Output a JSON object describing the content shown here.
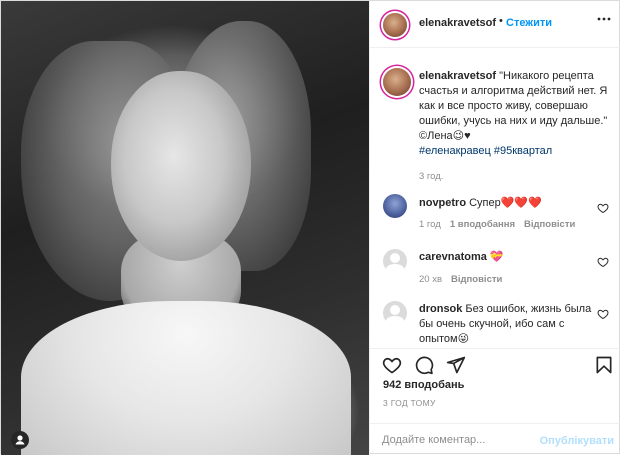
{
  "post": {
    "username": "elenakravetsof",
    "follow_label": "Стежити",
    "more_label": "•••"
  },
  "caption": {
    "username": "elenakravetsof",
    "text": " \"Никакого рецепта счастья и алгоритма действий нет. Я как и все просто живу, совершаю ошибки, учусь на них и иду дальше.\" ©Лена😉♥",
    "hashtags": "#еленакравец #95квартал",
    "timestamp": "3 год."
  },
  "comments": [
    {
      "username": "novpetro",
      "text": "Супер❤️❤️❤️",
      "time": "1 год",
      "likes": "1 вподобання",
      "reply": "Відповісти"
    },
    {
      "username": "carevnatoma",
      "text": "💝",
      "time": "20 хв",
      "reply": "Відповісти"
    },
    {
      "username": "dronsok",
      "text": "Без ошибок, жизнь была бы очень скучной, ибо сам с опытом😜"
    }
  ],
  "likes_count": "942 вподобань",
  "post_time": "3 ГОД ТОМУ",
  "add_comment": {
    "placeholder": "Додайте коментар...",
    "publish_label": "Опублікувати"
  },
  "colors": {
    "accent": "#0095f6",
    "hashtag": "#00376b",
    "muted": "#8e8e8e",
    "publish_disabled": "#b2dffc"
  },
  "icons": [
    "tag-person-icon",
    "more-options-icon",
    "like-icon",
    "comment-icon",
    "share-icon",
    "save-icon",
    "comment-like-icon"
  ]
}
